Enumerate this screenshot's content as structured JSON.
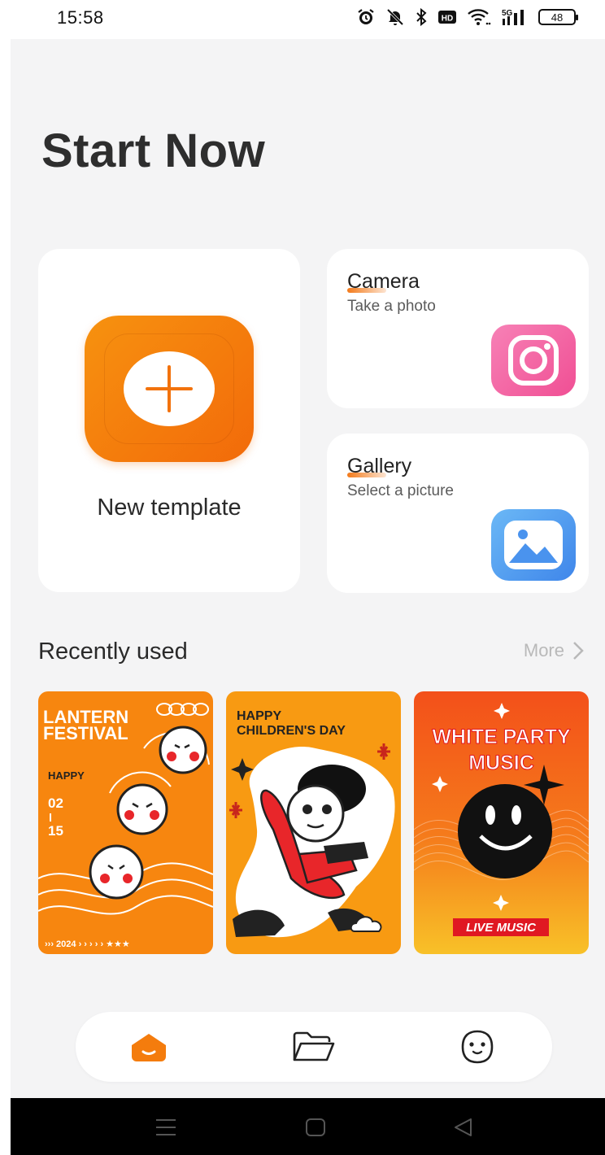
{
  "status_bar": {
    "time": "15:58",
    "network": "5G",
    "battery": "48",
    "icons": [
      "alarm-icon",
      "mute-icon",
      "bluetooth-icon",
      "hd-icon",
      "wifi-icon",
      "signal-icon",
      "battery-icon"
    ]
  },
  "page": {
    "title": "Start Now"
  },
  "actions": {
    "new_template": {
      "label": "New template",
      "icon": "plus-icon",
      "color": "#f47c0d"
    },
    "camera": {
      "title": "Camera",
      "subtitle": "Take a photo",
      "icon": "camera-icon",
      "color": "#f15f9f"
    },
    "gallery": {
      "title": "Gallery",
      "subtitle": "Select a picture",
      "icon": "image-icon",
      "color": "#4a93ee"
    }
  },
  "recent": {
    "title": "Recently used",
    "more": "More",
    "items": [
      {
        "line1": "LANTERN",
        "line2": "FESTIVAL",
        "happy": "HAPPY",
        "month": "02",
        "day": "15",
        "footer": "››› 2024 › › › › › ★★★",
        "bg": "#f7860f"
      },
      {
        "line1": "HAPPY",
        "line2": "CHILDREN'S DAY",
        "bg": "#f89a12"
      },
      {
        "line1": "WHITE PARTY",
        "line2": "MUSIC",
        "badge": "LIVE MUSIC",
        "bg": "#f3501a"
      }
    ]
  },
  "tabbar": {
    "tabs": [
      {
        "name": "home",
        "icon": "home-icon",
        "active": true
      },
      {
        "name": "files",
        "icon": "folder-icon",
        "active": false
      },
      {
        "name": "profile",
        "icon": "face-icon",
        "active": false
      }
    ],
    "accent": "#f47c0d"
  },
  "system_nav": [
    "menu-icon",
    "home-square-icon",
    "back-icon"
  ]
}
